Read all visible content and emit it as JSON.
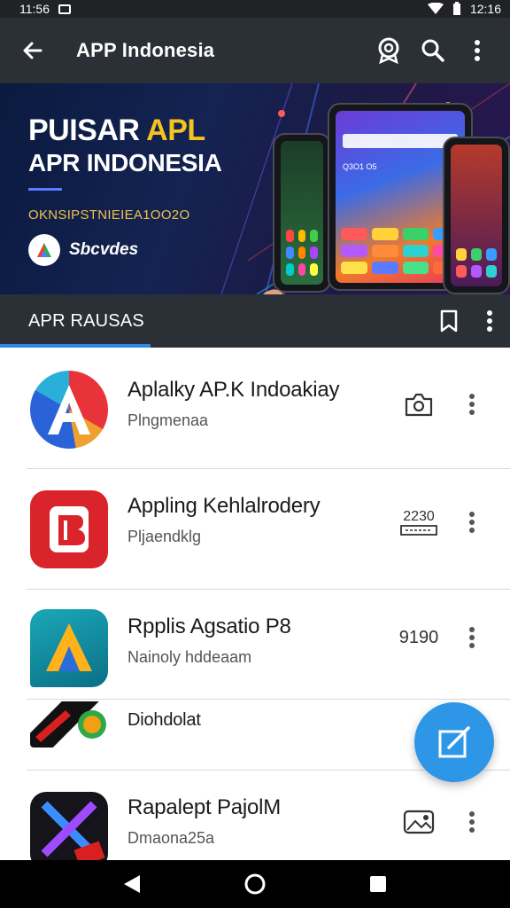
{
  "status_bar": {
    "time_left": "11:56",
    "time_right": "12:16"
  },
  "app_bar": {
    "title": "APP Indonesia",
    "icons": [
      "back-arrow-icon",
      "badge-icon",
      "search-icon",
      "more-vert-icon"
    ]
  },
  "banner": {
    "headline_part1": "PUISAR ",
    "headline_part2": "APL",
    "headline_line2": "APR INDONESIA",
    "subline": "OKNSIPSTNIEIEA1OO2O",
    "brand_label": "Sbcvdes",
    "phone_header": "Q3O1 O5",
    "accent_color": "#f4c320"
  },
  "section": {
    "title": "APR RAUSAS",
    "indicator_color": "#2f88e8"
  },
  "apps": [
    {
      "name": "Aplalky AP.K Indoakiay",
      "subtitle": "Plngmenaa",
      "action": "camera-icon"
    },
    {
      "name": "Appling Kehlalrodery",
      "subtitle": "Pljaendklg",
      "action_text": "2230",
      "action": "ticket-icon"
    },
    {
      "name": "Rpplis Agsatio P8",
      "subtitle": "Nainoly hddeaam",
      "action_text": "9190",
      "action": "counter"
    },
    {
      "name": "Diohdolat",
      "subtitle": "",
      "action": ""
    },
    {
      "name": "Rapalept PajolM",
      "subtitle": "Dmaona25a",
      "action": "photo-icon"
    }
  ],
  "fab": {
    "icon": "compose-icon",
    "color": "#2e96e6"
  },
  "nav_bar": {
    "buttons": [
      "back-triangle-icon",
      "home-circle-icon",
      "recents-square-icon"
    ]
  }
}
